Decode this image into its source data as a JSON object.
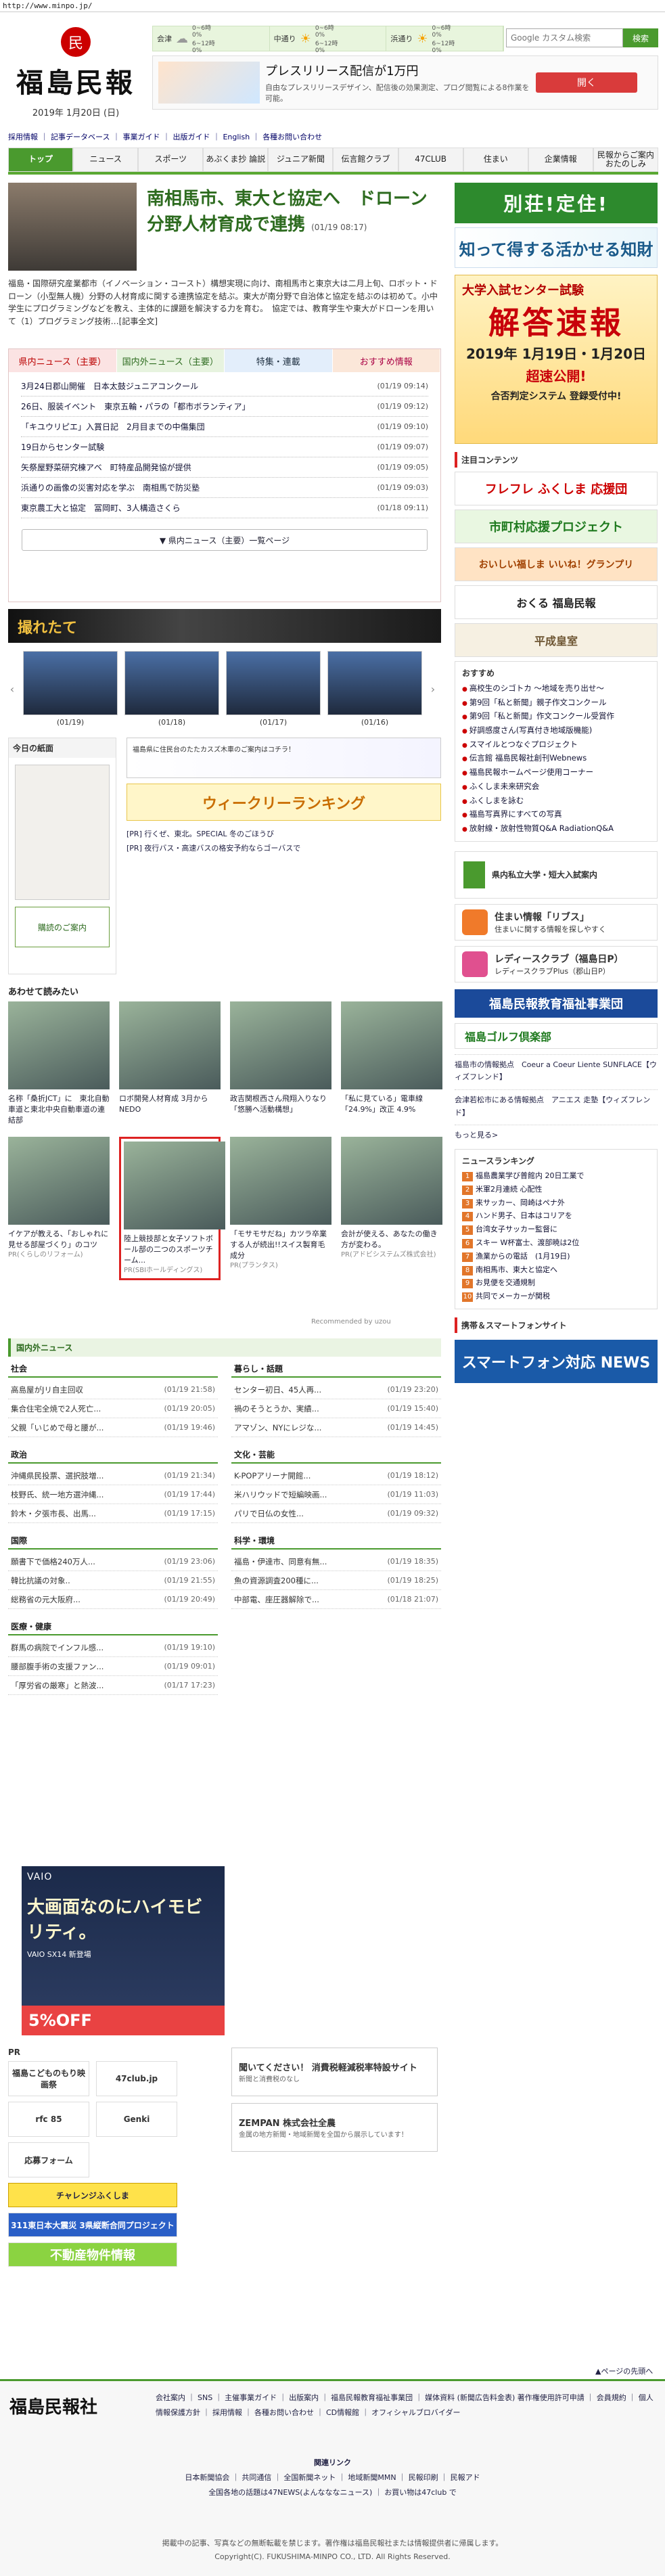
{
  "browser": {
    "url": "http://www.minpo.jp/"
  },
  "site": {
    "title": "福島民報",
    "date": "2019年 1月20日 (日)"
  },
  "weather": [
    {
      "label": "会津",
      "rain": [
        "0~6時",
        "0%",
        "6~12時",
        "0%"
      ],
      "icon": "cloud-icon"
    },
    {
      "label": "中通り",
      "rain": [
        "0~6時",
        "0%",
        "6~12時",
        "0%"
      ],
      "icon": "sun-icon"
    },
    {
      "label": "浜通り",
      "rain": [
        "0~6時",
        "0%",
        "6~12時",
        "0%"
      ],
      "icon": "sun-icon"
    }
  ],
  "search": {
    "placeholder": "Google カスタム検索",
    "button": "検索"
  },
  "topad": {
    "title": "プレスリリース配信が1万円",
    "sub": "自由なプレスリリースデザイン、配信後の効果測定、プログ閲覧による8作業を可能。",
    "btn": "開く"
  },
  "utility": [
    "採用情報",
    "記事データベース",
    "事業ガイド",
    "出版ガイド",
    "English",
    "各種お問い合わせ"
  ],
  "gnav": [
    "トップ",
    "ニュース",
    "スポーツ",
    "あぶくま抄 論説",
    "ジュニア新聞",
    "伝言館クラブ",
    "47CLUB",
    "住まい",
    "企業情報",
    "民報からご案内 おたのしみ"
  ],
  "lead": {
    "title": "南相馬市、東大と協定へ　ドローン分野人材育成で連携",
    "date": "(01/19 08:17)",
    "body": "福島・国際研究産業都市（イノベーション・コースト）構想実現に向け、南相馬市と東京大は二月上旬、ロボット・ドローン（小型無人機）分野の人材育成に関する連携協定を結ぶ。東大が南分野で自治体と協定を結ぶのは初めて。小中学生にプログラミングなどを教え、主体的に課題を解決する力を育む。　協定では、教育学生や東大がドローンを用いて（1）プログラミング技術…[記事全文]"
  },
  "tabs": [
    "県内ニュース（主要）",
    "国内外ニュース（主要）",
    "特集・連載",
    "おすすめ情報"
  ],
  "news": [
    {
      "t": "3月24日郡山開催　日本太鼓ジュニアコンクール",
      "d": "(01/19 09:14)"
    },
    {
      "t": "26日、服装イベント　東京五輪・パラの「都市ボランティア」",
      "d": "(01/19 09:12)"
    },
    {
      "t": "「キユウリピエ」入賞日記　2月目までの中傷集団",
      "d": "(01/19 09:10)"
    },
    {
      "t": "19日からセンター試験",
      "d": "(01/19 09:07)"
    },
    {
      "t": "矢祭屋野菜研究棟アベ　町特産品開発協が提供",
      "d": "(01/19 09:05)"
    },
    {
      "t": "浜通りの画像の災害対応を学ぶ　南相馬で防災塾",
      "d": "(01/19 09:03)"
    },
    {
      "t": "東京農工大と協定　冨岡町、3人構造さくら",
      "d": "(01/18 09:11)"
    }
  ],
  "news_more": "▼ 県内ニュース（主要）一覧ページ",
  "photos": {
    "header": "撮れたて",
    "items": [
      "(01/19)",
      "(01/18)",
      "(01/17)",
      "(01/16)"
    ]
  },
  "paper": {
    "header": "今日の紙面",
    "buy": "購読のご案内"
  },
  "midad": {
    "line1": "福島県に住民台のたたカスズ木車のご案内はコチラ！",
    "line2": "ウィークリーランキング"
  },
  "prlinks": [
    "[PR] 行くぜ、東北。SPECIAL 冬のごほうび",
    "[PR] 夜行バス・高速バスの格安予約ならゴーバスで"
  ],
  "aw_title": "あわせて読みたい",
  "aw_row1": [
    {
      "t": "名称「桑折JCT」に　東北自動車道と東北中央自動車道の連結部"
    },
    {
      "t": "ロボ開発人材育成 3月から　NEDO"
    },
    {
      "t": "政吉関根西さん飛翔入りなり「悠勝へ活動構想」"
    },
    {
      "t": "「私に見ている」電車線「24.9%」改正 4.9%"
    }
  ],
  "aw_row2": [
    {
      "t": "イケアが教える、「おしゃれに見せる部屋づくり」のコツ",
      "pr": "PR(くらしのリフォーム)"
    },
    {
      "t": "陸上競技部と女子ソフトボール部の二つのスポーツチーム...",
      "pr": "PR(SBIホールディングス)"
    },
    {
      "t": "「モサモサだね」カツラ卒業する人が続出!!スイス製育毛成分",
      "pr": "PR(プランタス)"
    },
    {
      "t": "会計が使える、あなたの働き方が変わる。",
      "pr": "PR(アドビシステムズ株式会社)"
    }
  ],
  "reco": "Recommended by uzou",
  "sec_news": "国内外ニュース",
  "secs": [
    {
      "h": "社会",
      "items": [
        [
          "高島屋がJリ自主回収",
          "(01/19 21:58)"
        ],
        [
          "集合住宅全焼で2人死亡...",
          "(01/19 20:05)"
        ],
        [
          "父親「いじめで母と腰が...",
          "(01/19 19:46)"
        ]
      ]
    },
    {
      "h": "暮らし・話題",
      "items": [
        [
          "センター初日、45人再...",
          "(01/19 23:20)"
        ],
        [
          "禍のそうとうか、実績...",
          "(01/19 15:40)"
        ],
        [
          "アマゾン、NYにレジな...",
          "(01/19 14:45)"
        ]
      ]
    },
    {
      "h": "政治",
      "items": [
        [
          "沖縄県民投票、選択肢増...",
          "(01/19 21:34)"
        ],
        [
          "枝野氏、統一地方選沖縄...",
          "(01/19 17:44)"
        ],
        [
          "鈴木・夕張市長、出馬...",
          "(01/19 17:15)"
        ]
      ]
    },
    {
      "h": "文化・芸能",
      "items": [
        [
          "K-POPアリーナ開館...",
          "(01/19 18:12)"
        ],
        [
          "米ハリウッドで短編映画...",
          "(01/19 11:03)"
        ],
        [
          "パリで日仏の女性...",
          "(01/19 09:32)"
        ]
      ]
    },
    {
      "h": "国際",
      "items": [
        [
          "願書下で価格240万人...",
          "(01/19 23:06)"
        ],
        [
          "韓比抗議の対象..",
          "(01/19 21:55)"
        ],
        [
          "総務省の元大阪府...",
          "(01/19 20:49)"
        ]
      ]
    },
    {
      "h": "科学・環境",
      "items": [
        [
          "福島・伊達市、同意有無...",
          "(01/19 18:35)"
        ],
        [
          "魚の資源調査200種に...",
          "(01/19 18:25)"
        ],
        [
          "中部電、座圧器解除で...",
          "(01/18 21:07)"
        ]
      ]
    },
    {
      "h": "医療・健康",
      "items": [
        [
          "群馬の病院でインフル感...",
          "(01/19 19:10)"
        ],
        [
          "腰部腹手術の支援ファン...",
          "(01/19 09:01)"
        ],
        [
          "「厚労省の厳寒」と熱波...",
          "(01/17 17:23)"
        ]
      ]
    }
  ],
  "bigad": {
    "hd": "VAIO",
    "mid": "大画面なのにハイモビリティ。",
    "sub": "VAIO SX14 新登場",
    "foot": "5%OFF"
  },
  "pr": {
    "hd": "PR",
    "tiles": [
      "福島こどものもり映画祭",
      "47club.jp",
      "rfc 85",
      "Genki",
      "応募フォーム",
      "チャレンジふくしま",
      "311東日本大震災 3県縦断合同プロジェクト",
      "不動産物件情報"
    ]
  },
  "prads2": [
    {
      "b": "聞いてください！ 消費税軽減税率特設サイト",
      "s": "新聞と消費税のなし"
    },
    {
      "b": "ZEMPAN 株式会社全農",
      "s": "金属の地方新聞・地域新聞を全国から展示しています！"
    }
  ],
  "side": {
    "sb1": "別荘!定住!",
    "sb2": "知って得する活かせる知財",
    "sb3": {
      "t1": "大学入試センター試験",
      "t2": "解答速報",
      "t3": "2019年 1月19日・1月20日",
      "t4": "超速公開!",
      "t5": "合否判定システム 登録受付中!"
    },
    "h1": "注目コンテンツ",
    "tiles": [
      "フレフレ ふくしま 応援団",
      "市町村応援プロジェクト",
      "おいしい福しま いいね！グランプリ",
      "おくる 福島民報",
      "平成皇室"
    ],
    "links_h": "おすすめ",
    "links": [
      "高校生のシゴトカ ～地域を売り出せ～",
      "第9回「私と新聞」親子作文コンクール",
      "第9回「私と新聞」作文コンクール受賞作",
      "好調感度さん(写真付き地域版機能)",
      "スマイルとつなぐプロジェクト",
      "伝言館 福島民報社創刊Webnews",
      "福島民報ホームページ使用コーナー",
      "ふくしま未来研究会",
      "ふくしまを詠む",
      "福島写真界にすべての写真",
      "放射線・放射性物質Q&A RadiationQ&A"
    ],
    "uni": "県内私立大学・短大入試案内",
    "t2": [
      {
        "b": "住まい情報「リブス」",
        "s": "住まいに関する情報を探しやすく"
      },
      {
        "b": "レディースクラブ（福島日P）",
        "s": "レディースクラブPlus（郡山日P）"
      }
    ],
    "welfare": "福島民報教育福祉事業団",
    "golf": "福島ゴルフ倶楽部",
    "text1": "福島市の情報拠点　Coeur a Coeur Liente SUNFLACE【ウィズフレンド】",
    "text2": "会津若松市にある情報拠点　アニエス 走塾【ウィズフレンド】",
    "more": "もっと見る>",
    "rank_h": "ニュースランキング",
    "rank": [
      "福島農業学び普館内 20日工業で",
      "米軍2月連続 心配性",
      "来サッカー、岡崎はペナ外",
      "ハンド男子、日本はコリアを",
      "台湾女子サッカー監督に",
      "スキー W杯富士、渡部暁は2位",
      "漁業からの電話　(1月19日)",
      "南相馬市、東大と協定へ",
      "お見便を交通規制",
      "共同でメーカーが関税"
    ],
    "smart_h": "携帯＆スマートフォンサイト",
    "smart": "スマートフォン対応 NEWS"
  },
  "pagetop": "▲ページの先頭へ",
  "footer": {
    "logo": "福島民報社",
    "links": "会社案内 ｜ SNS ｜ 主催事業ガイド ｜ 出版案内 ｜ 福島民報教育福祉事業団 ｜ 媒体資料 (新聞広告料金表) 著作権使用許可申請 ｜ 会員規約 ｜ 個人情報保護方針 ｜ 採用情報 ｜ 各種お問い合わせ ｜ CD情報館 ｜ オフィシャルブロバイダー",
    "rel_h": "関連リンク",
    "rel1": "日本新聞協会 ｜ 共同通信 ｜ 全国新聞ネット ｜ 地域新聞MMN ｜ 民報印刷 ｜ 民報アド",
    "rel2": "全国各地の話題は47NEWS(よんなななニュース) ｜ お買い物は47club で",
    "copy1": "掲載中の記事、写真などの無断転載を禁じます。著作権は福島民報社または情報提供者に帰属します。",
    "copy2": "Copyright(C). FUKUSHIMA-MINPO CO., LTD. All Rights Reserved."
  }
}
